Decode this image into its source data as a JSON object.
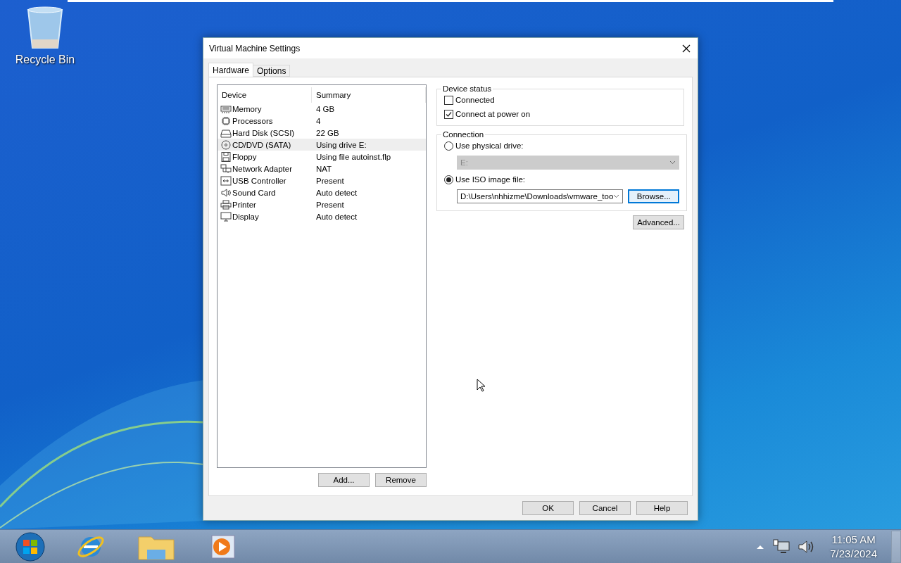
{
  "desktop": {
    "icons": [
      {
        "label": "Recycle Bin"
      }
    ]
  },
  "dialog": {
    "title": "Virtual Machine Settings",
    "tabs": [
      {
        "label": "Hardware",
        "selected": true
      },
      {
        "label": "Options",
        "selected": false
      }
    ],
    "device_table": {
      "columns": [
        "Device",
        "Summary"
      ],
      "rows": [
        {
          "kind": "memory",
          "device": "Memory",
          "summary": "4 GB",
          "selected": false
        },
        {
          "kind": "processor",
          "device": "Processors",
          "summary": "4",
          "selected": false
        },
        {
          "kind": "disk",
          "device": "Hard Disk (SCSI)",
          "summary": "22 GB",
          "selected": false
        },
        {
          "kind": "cd",
          "device": "CD/DVD (SATA)",
          "summary": "Using drive E:",
          "selected": true
        },
        {
          "kind": "floppy",
          "device": "Floppy",
          "summary": "Using file autoinst.flp",
          "selected": false
        },
        {
          "kind": "network",
          "device": "Network Adapter",
          "summary": "NAT",
          "selected": false
        },
        {
          "kind": "usb",
          "device": "USB Controller",
          "summary": "Present",
          "selected": false
        },
        {
          "kind": "sound",
          "device": "Sound Card",
          "summary": "Auto detect",
          "selected": false
        },
        {
          "kind": "printer",
          "device": "Printer",
          "summary": "Present",
          "selected": false
        },
        {
          "kind": "display",
          "device": "Display",
          "summary": "Auto detect",
          "selected": false
        }
      ]
    },
    "add_button": "Add...",
    "remove_button": "Remove",
    "device_status": {
      "title": "Device status",
      "options": [
        {
          "label": "Connected",
          "checked": false
        },
        {
          "label": "Connect at power on",
          "checked": true
        }
      ]
    },
    "connection": {
      "title": "Connection",
      "options": [
        {
          "label": "Use physical drive:",
          "selected": false,
          "dropdown": {
            "value": "E:",
            "disabled": true
          }
        },
        {
          "label": "Use ISO image file:",
          "selected": true,
          "dropdown": {
            "value": "D:\\Users\\nhhizme\\Downloads\\vmware_too",
            "disabled": false
          },
          "button": {
            "label": "Browse...",
            "focused": true
          }
        }
      ]
    },
    "advanced_button": "Advanced...",
    "buttons": [
      "OK",
      "Cancel",
      "Help"
    ]
  },
  "taskbar": {
    "clock": {
      "time": "11:05 AM",
      "date": "7/23/2024"
    }
  }
}
